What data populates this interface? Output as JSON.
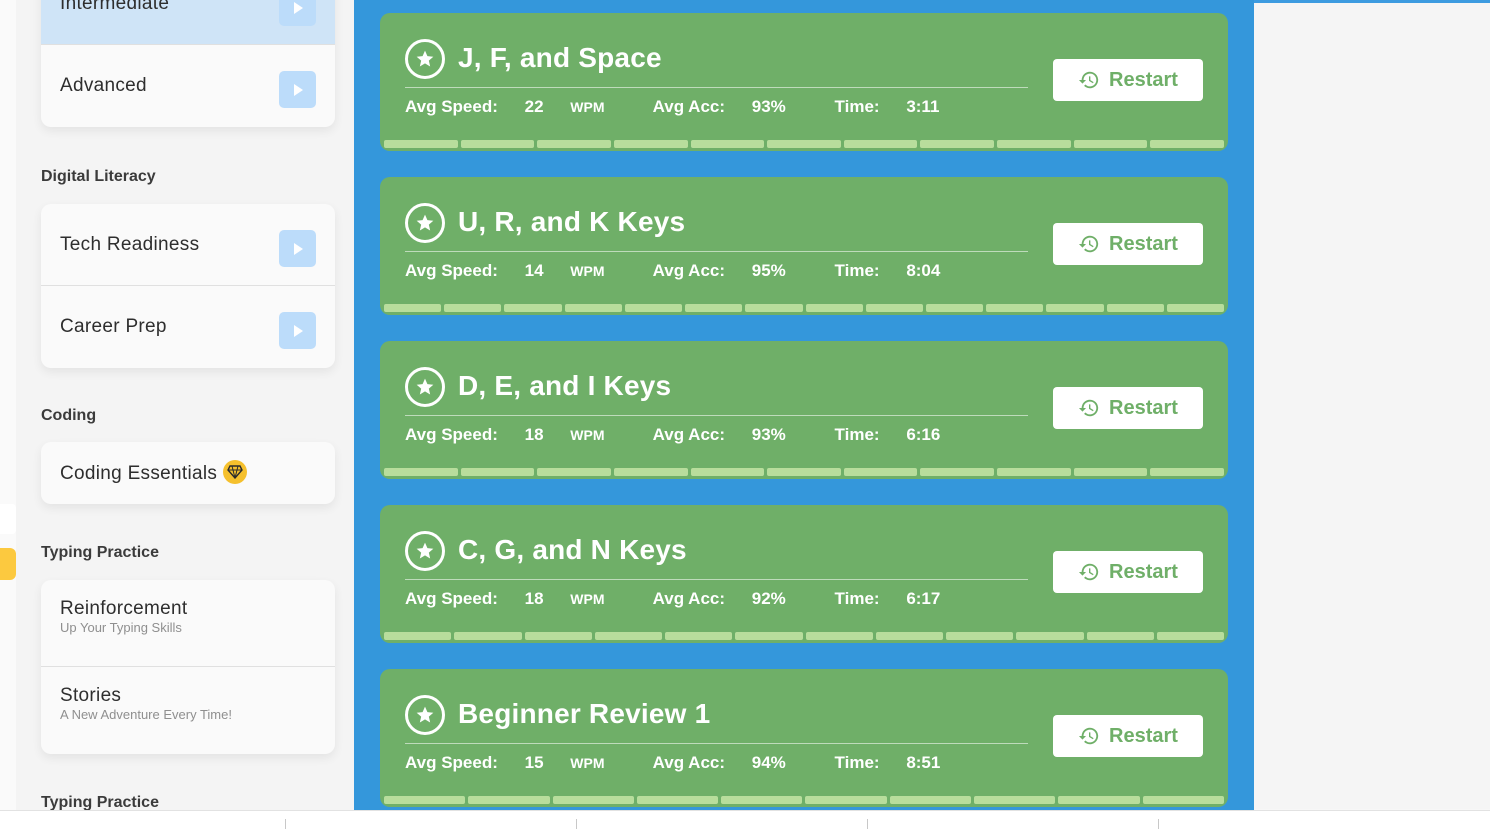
{
  "sidebar": {
    "top_group": [
      {
        "label": "Intermediate"
      },
      {
        "label": "Advanced"
      }
    ],
    "sections": [
      {
        "title": "Digital Literacy",
        "items": [
          {
            "label": "Tech Readiness"
          },
          {
            "label": "Career Prep"
          }
        ]
      },
      {
        "title": "Coding",
        "items": [
          {
            "label": "Coding Essentials",
            "badge_icon": "gem-icon"
          }
        ]
      },
      {
        "title": "Typing Practice",
        "items": [
          {
            "label": "Reinforcement",
            "subtitle": "Up Your Typing Skills"
          },
          {
            "label": "Stories",
            "subtitle": "A New Adventure Every Time!"
          }
        ]
      },
      {
        "title": "Typing Practice"
      }
    ]
  },
  "lessons": [
    {
      "title": "J, F, and Space",
      "speed_label": "Avg Speed:",
      "speed": "22",
      "unit": "WPM",
      "acc_label": "Avg Acc:",
      "acc": "93%",
      "time_label": "Time:",
      "time": "3:11",
      "restart": "Restart",
      "segments": 11
    },
    {
      "title": "U, R, and K Keys",
      "speed_label": "Avg Speed:",
      "speed": "14",
      "unit": "WPM",
      "acc_label": "Avg Acc:",
      "acc": "95%",
      "time_label": "Time:",
      "time": "8:04",
      "restart": "Restart",
      "segments": 14
    },
    {
      "title": "D, E, and I Keys",
      "speed_label": "Avg Speed:",
      "speed": "18",
      "unit": "WPM",
      "acc_label": "Avg Acc:",
      "acc": "93%",
      "time_label": "Time:",
      "time": "6:16",
      "restart": "Restart",
      "segments": 11
    },
    {
      "title": "C, G, and N Keys",
      "speed_label": "Avg Speed:",
      "speed": "18",
      "unit": "WPM",
      "acc_label": "Avg Acc:",
      "acc": "92%",
      "time_label": "Time:",
      "time": "6:17",
      "restart": "Restart",
      "segments": 12
    },
    {
      "title": "Beginner Review 1",
      "speed_label": "Avg Speed:",
      "speed": "15",
      "unit": "WPM",
      "acc_label": "Avg Acc:",
      "acc": "94%",
      "time_label": "Time:",
      "time": "8:51",
      "restart": "Restart",
      "segments": 10
    }
  ],
  "colors": {
    "main_bg": "#3497db",
    "lesson_green": "#6faf68",
    "progress_segment": "#b8dd9c",
    "play_button": "#bcdcfa",
    "premium_gem": "#f5c02d"
  }
}
